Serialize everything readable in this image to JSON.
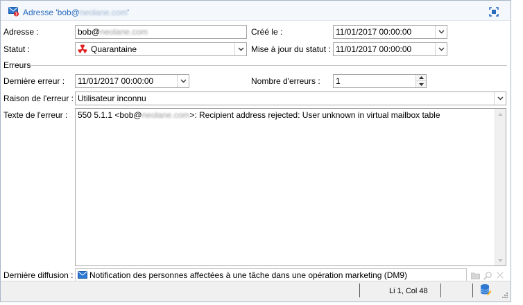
{
  "window": {
    "title_prefix": "Adresse 'bob@",
    "title_blurred": "neolane.com",
    "title_suffix": "'"
  },
  "fields": {
    "adresse_label": "Adresse :",
    "adresse_value_prefix": "bob@",
    "adresse_value_blurred": "neolane.com",
    "cree_label": "Créé le :",
    "cree_value": "11/01/2017 00:00:00",
    "statut_label": "Statut :",
    "statut_value": "Quarantaine",
    "maj_label": "Mise à jour du statut :",
    "maj_value": "11/01/2017 00:00:00"
  },
  "erreurs": {
    "section_label": "Erreurs",
    "derniere_erreur_label": "Dernière erreur :",
    "derniere_erreur_value": "11/01/2017 00:00:00",
    "nombre_label": "Nombre d'erreurs :",
    "nombre_value": "1",
    "raison_label": "Raison de l'erreur :",
    "raison_value": "Utilisateur inconnu",
    "texte_label": "Texte de l'erreur :",
    "texte_prefix": "550 5.1.1 <bob@",
    "texte_blurred": "neolane.com",
    "texte_suffix": ">: Recipient address rejected:  User unknown in virtual mailbox table"
  },
  "diffusion": {
    "label": "Dernière diffusion :",
    "value": "Notification des personnes affectées à une tâche dans une opération marketing (DM9)"
  },
  "status": {
    "position": "Li 1, Col 48"
  },
  "icons": {
    "title": "email-error-icon",
    "maximize": "maximize-icon",
    "statut": "radioactive-icon",
    "diffusion": "email-icon",
    "folder": "folder-icon",
    "search": "search-icon",
    "clear": "clear-icon",
    "database": "database-icon"
  },
  "colors": {
    "accent": "#2a6dbf",
    "quarantine": "#e02020"
  }
}
